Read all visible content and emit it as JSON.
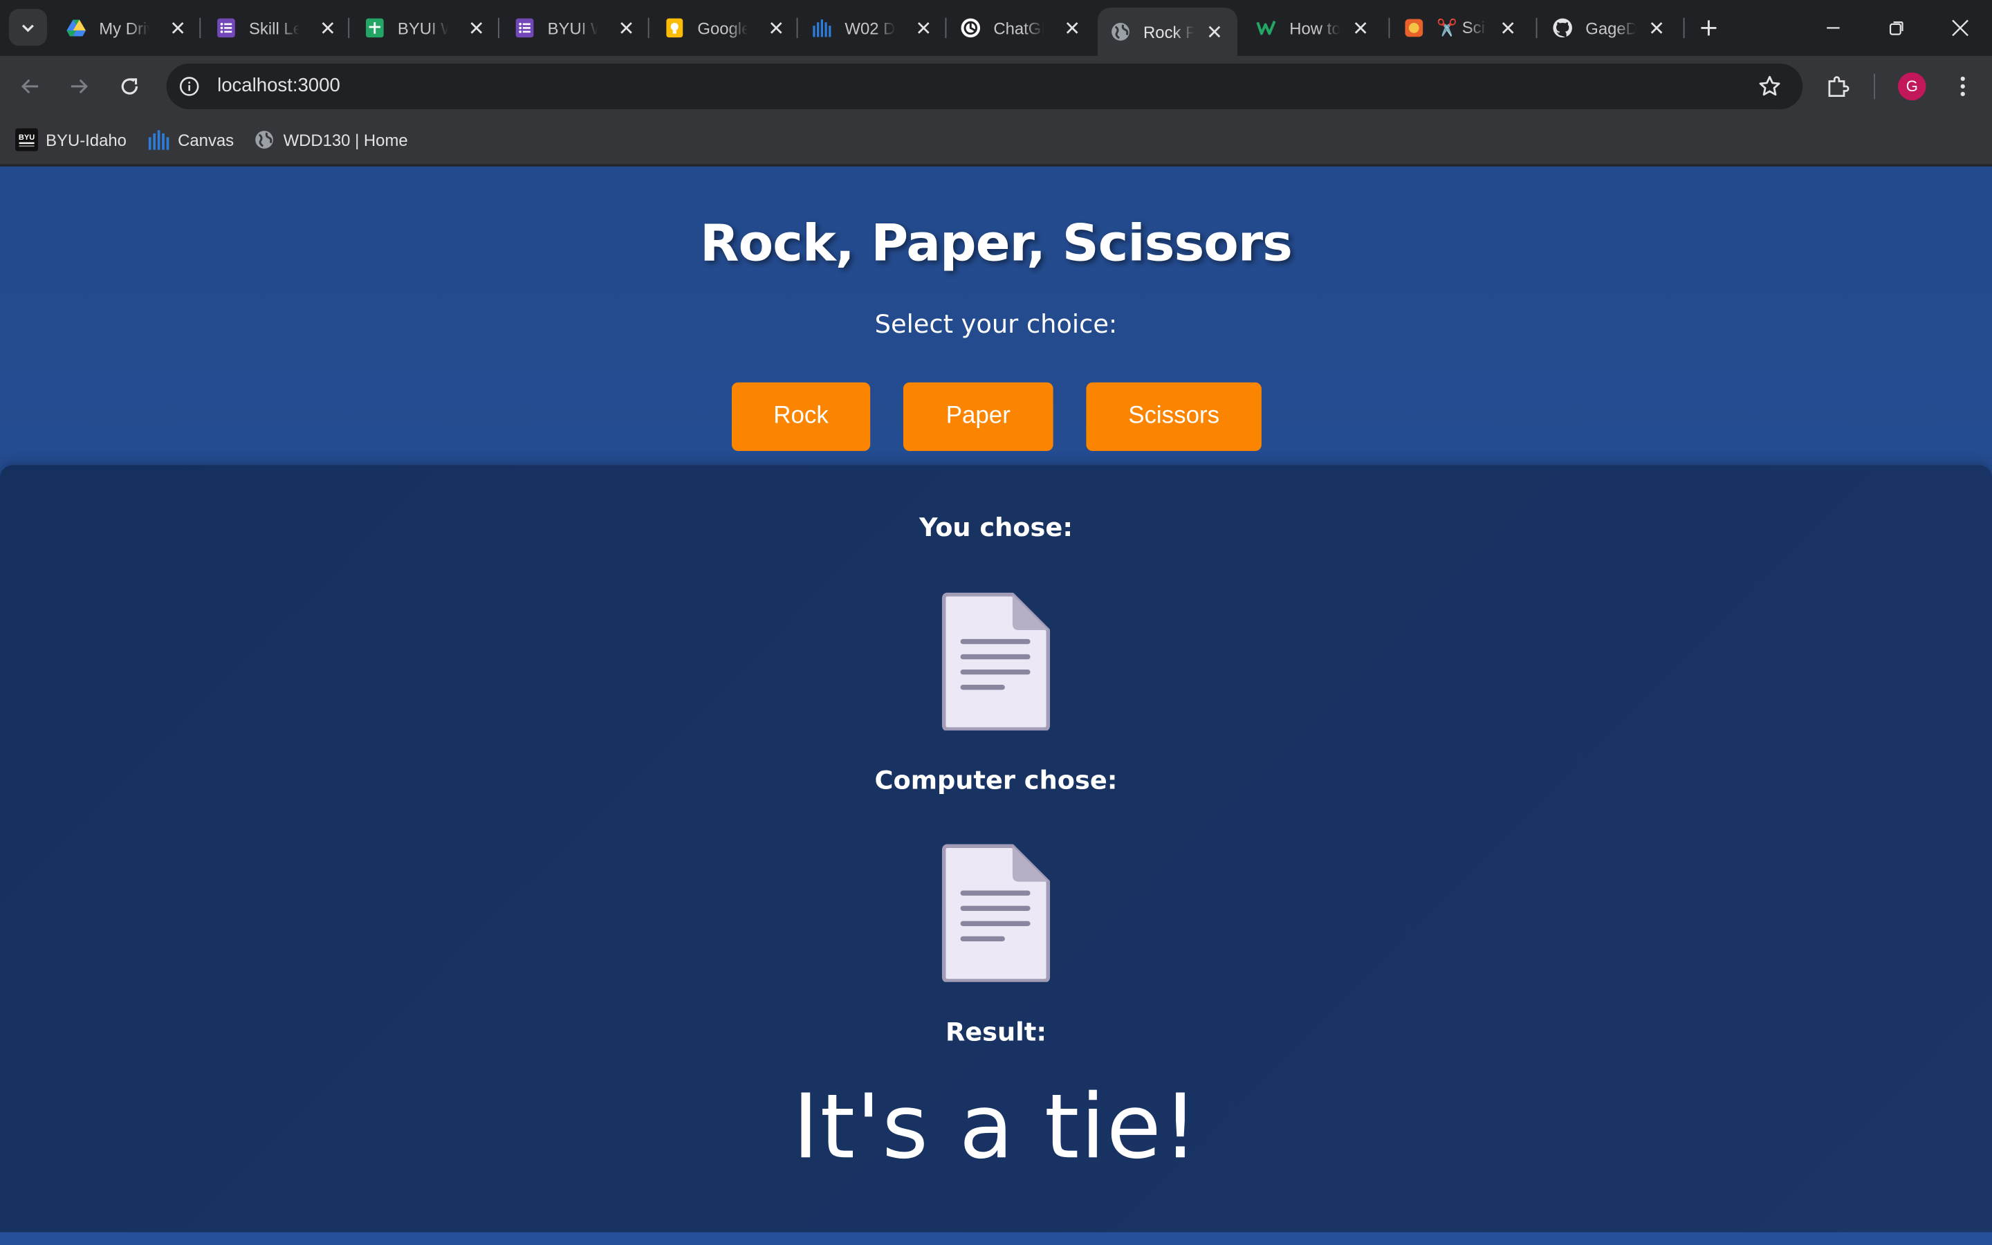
{
  "browser": {
    "tabs": [
      {
        "title": "My Drive",
        "icon": "google-drive-icon"
      },
      {
        "title": "Skill Level",
        "icon": "google-forms-icon"
      },
      {
        "title": "BYUI W",
        "icon": "google-sheets-icon"
      },
      {
        "title": "BYUI W",
        "icon": "google-forms-icon"
      },
      {
        "title": "Google",
        "icon": "google-keep-icon"
      },
      {
        "title": "W02 D",
        "icon": "canvas-icon"
      },
      {
        "title": "ChatGPT",
        "icon": "chatgpt-icon"
      },
      {
        "title": "Rock P",
        "icon": "globe-icon",
        "active": true
      },
      {
        "title": "How to",
        "icon": "wikihow-icon"
      },
      {
        "title": "✂️ Sci",
        "icon": "html5-icon"
      },
      {
        "title": "GageD",
        "icon": "github-icon"
      }
    ],
    "address": "localhost:3000",
    "profile_initial": "G",
    "bookmarks": [
      {
        "label": "BYU-Idaho",
        "icon": "byu-logo-icon"
      },
      {
        "label": "Canvas",
        "icon": "canvas-icon"
      },
      {
        "label": "WDD130 | Home",
        "icon": "globe-icon"
      }
    ]
  },
  "game": {
    "title": "Rock, Paper, Scissors",
    "prompt": "Select your choice:",
    "choices": {
      "rock": "Rock",
      "paper": "Paper",
      "scissors": "Scissors"
    },
    "you_chose_label": "You chose:",
    "player_choice_icon": "page-facing-up-icon",
    "computer_chose_label": "Computer chose:",
    "computer_choice_icon": "page-facing-up-icon",
    "result_label": "Result:",
    "result_text": "It's a tie!"
  },
  "colors": {
    "page_bg": "#234a8c",
    "results_bg": "#16305e",
    "button_bg": "#fb8500",
    "text": "#ffffff"
  }
}
